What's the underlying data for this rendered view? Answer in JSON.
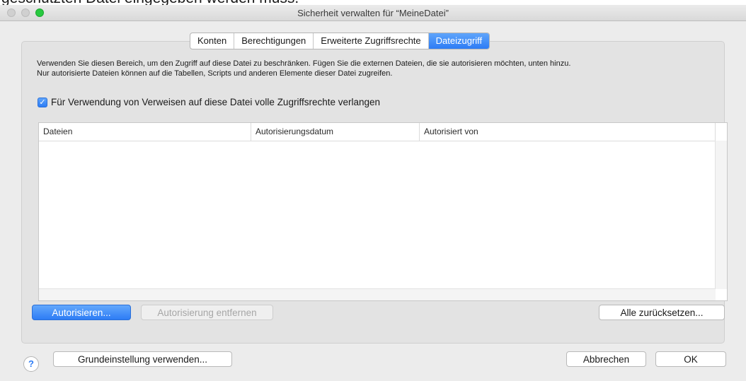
{
  "background_fragment": "geschützten Datei eingegeben werden muss.",
  "window": {
    "title": "Sicherheit verwalten für “MeineDatei”"
  },
  "tabs": [
    {
      "label": "Konten",
      "active": false
    },
    {
      "label": "Berechtigungen",
      "active": false
    },
    {
      "label": "Erweiterte Zugriffsrechte",
      "active": false
    },
    {
      "label": "Dateizugriff",
      "active": true
    }
  ],
  "description": {
    "line1": "Verwenden Sie diesen Bereich, um den Zugriff auf diese Datei zu beschränken. Fügen Sie die externen Dateien, die sie autorisieren möchten, unten hinzu.",
    "line2": "Nur autorisierte Dateien können auf die Tabellen, Scripts und anderen Elemente dieser Datei zugreifen."
  },
  "checkbox": {
    "label": "Für Verwendung von Verweisen auf diese Datei volle Zugriffsrechte verlangen",
    "checked": true
  },
  "table": {
    "columns": [
      "Dateien",
      "Autorisierungsdatum",
      "Autorisiert von"
    ],
    "rows": []
  },
  "buttons": {
    "authorize": "Autorisieren...",
    "remove_authorization": "Autorisierung entfernen",
    "reset_all": "Alle zurücksetzen...",
    "use_default": "Grundeinstellung verwenden...",
    "cancel": "Abbrechen",
    "ok": "OK"
  },
  "help_icon": "?",
  "colors": {
    "accent": "#2d7cf5",
    "window_bg": "#ececec",
    "panel_bg": "#e3e3e3"
  }
}
